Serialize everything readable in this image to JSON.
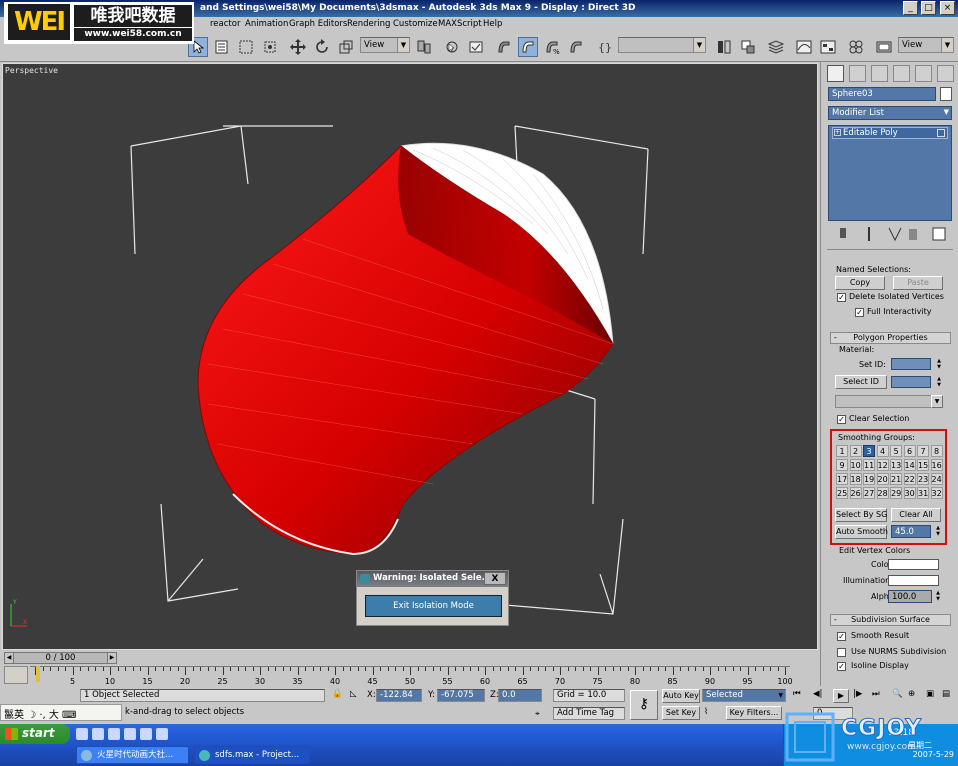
{
  "window": {
    "title": "and Settings\\wei58\\My Documents\\3dsmax   - Autodesk 3ds Max 9   - Display : Direct 3D"
  },
  "watermark": {
    "logo_text": "WEI",
    "logo_cn": "唯我吧数据",
    "logo_url": "www.wei58.com.cn",
    "cgjoy": "CGJOY",
    "cgjoy_url": "www.cgjoy.com"
  },
  "menu": {
    "items": [
      "reactor",
      "Animation",
      "Graph Editors",
      "Rendering",
      "Customize",
      "MAXScript",
      "Help"
    ]
  },
  "toolbar": {
    "ref_coord": "View",
    "named_sel": "",
    "view_right": "View"
  },
  "viewport": {
    "label": "Perspective",
    "colors": {
      "background": "#3c3c3c",
      "mesh_red": "#d40000",
      "mesh_white": "#ffffff"
    }
  },
  "warning_dialog": {
    "title": "Warning: Isolated Sele...",
    "close": "X",
    "button": "Exit Isolation Mode"
  },
  "command_panel": {
    "object_name": "Sphere03",
    "modifier_list": "Modifier List",
    "stack_item": "Editable Poly",
    "named_selections": {
      "label": "Named Selections:",
      "copy": "Copy",
      "paste": "Paste",
      "delete_isolated": "Delete Isolated Vertices",
      "full_interactivity": "Full Interactivity"
    },
    "polygon_properties": {
      "header": "Polygon Properties",
      "material_label": "Material:",
      "set_id": "Set ID:",
      "select_id": "Select ID",
      "clear_selection": "Clear Selection",
      "smoothing_groups": "Smoothing Groups:",
      "groups": [
        "1",
        "2",
        "3",
        "4",
        "5",
        "6",
        "7",
        "8",
        "9",
        "10",
        "11",
        "12",
        "13",
        "14",
        "15",
        "16",
        "17",
        "18",
        "19",
        "20",
        "21",
        "22",
        "23",
        "24",
        "25",
        "26",
        "27",
        "28",
        "29",
        "30",
        "31",
        "32"
      ],
      "active_group": "3",
      "select_by_sg": "Select By SG",
      "clear_all": "Clear All",
      "auto_smooth": "Auto Smooth",
      "auto_smooth_value": "45.0"
    },
    "edit_vertex_colors": {
      "label": "Edit Vertex Colors",
      "color": "Color:",
      "illumination": "Illumination:",
      "alpha": "Alpha:",
      "alpha_value": "100.0"
    },
    "subdivision_surface": {
      "header": "Subdivision Surface",
      "smooth_result": "Smooth Result",
      "use_nurms": "Use NURMS Subdivision",
      "isoline_display": "Isoline Display"
    }
  },
  "trackbar": {
    "time_slider": "0 / 100",
    "ticks": [
      "5",
      "10",
      "15",
      "20",
      "25",
      "30",
      "35",
      "40",
      "45",
      "50",
      "55",
      "60",
      "65",
      "70",
      "75",
      "80",
      "85",
      "90",
      "95",
      "100"
    ]
  },
  "status": {
    "selection": "1 Object Selected",
    "prompt": "k-and-drag to select objects",
    "x_label": "X:",
    "x_value": "-122.84",
    "y_label": "Y:",
    "y_value": "-67.075",
    "z_label": "Z:",
    "z_value": "0.0",
    "grid": "Grid = 10.0",
    "add_time_tag": "Add Time Tag",
    "auto_key": "Auto Key",
    "selected": "Selected",
    "set_key": "Set Key",
    "key_filters": "Key Filters...",
    "frame": "0"
  },
  "ime": {
    "text": "鬣英 ☽ ·, 大 ⌨"
  },
  "taskbar": {
    "start": "start",
    "tasks": [
      "火星时代动画大社...",
      "sdfs.max   - Project..."
    ],
    "clock_time": "13:18",
    "clock_date": "2007-5-29",
    "clock_day": "星期二"
  }
}
